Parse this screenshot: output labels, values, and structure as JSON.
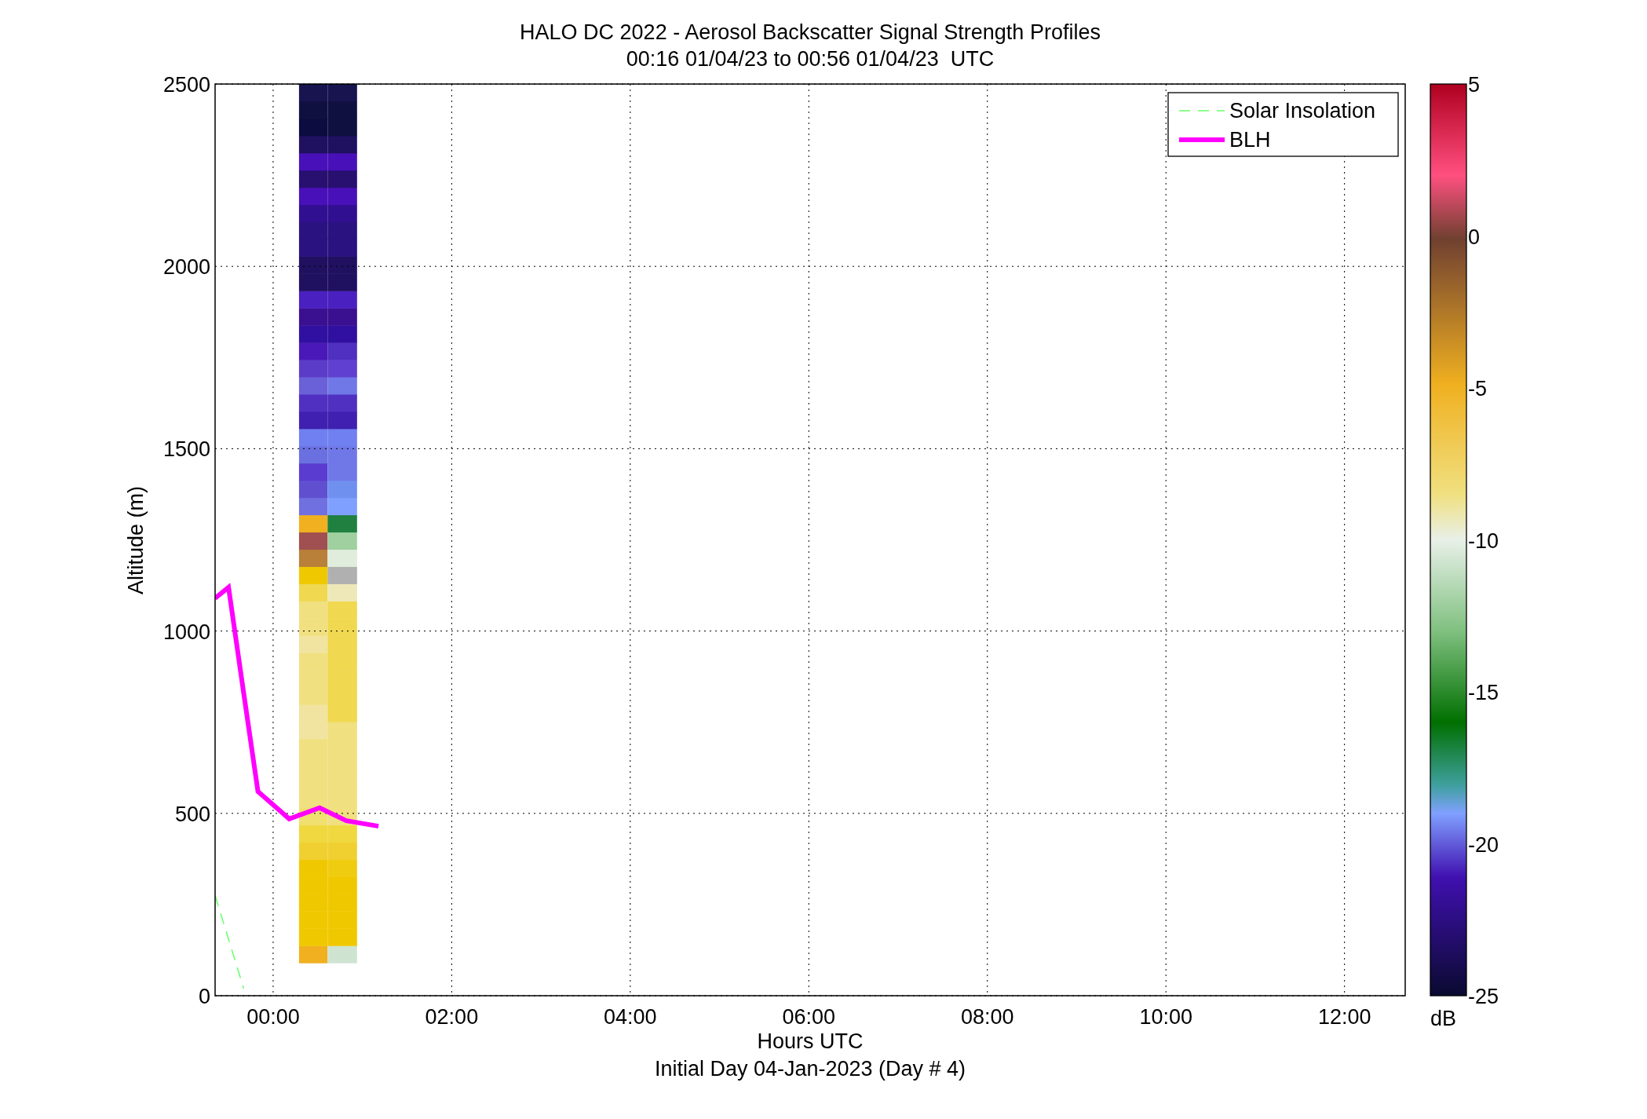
{
  "figure": {
    "subtitle": "00:16 01/04/23 to 00:56 01/04/23  UTC",
    "caption": "Initial Day 04-Jan-2023 (Day # 4)"
  },
  "chart_data": {
    "type": "line",
    "title": "HALO DC 2022 - Aerosol Backscatter Signal Strength Profiles",
    "xlabel": "Hours UTC",
    "ylabel": "Altitude (m)",
    "x": [
      -0.65,
      -0.5,
      -0.33,
      -0.17,
      0.18,
      0.52,
      0.82,
      1.18
    ],
    "series": [
      {
        "name": "Solar Insolation",
        "color": "#66ff66",
        "line_style": "dashed",
        "values": [
          275,
          155,
          20,
          null,
          null,
          null,
          null,
          null
        ]
      },
      {
        "name": "BLH",
        "color": "#ff00ff",
        "line_style": "solid",
        "values": [
          1090,
          1120,
          830,
          560,
          485,
          515,
          480,
          465
        ]
      }
    ],
    "grid": true,
    "legend": true,
    "xlim": [
      -0.65,
      12.68
    ],
    "ylim": [
      0,
      2500
    ],
    "xticks": [
      {
        "value": 0,
        "label": "00:00"
      },
      {
        "value": 2,
        "label": "02:00"
      },
      {
        "value": 4,
        "label": "04:00"
      },
      {
        "value": 6,
        "label": "06:00"
      },
      {
        "value": 8,
        "label": "08:00"
      },
      {
        "value": 10,
        "label": "10:00"
      },
      {
        "value": 12,
        "label": "12:00"
      }
    ],
    "yticks": [
      0,
      500,
      1000,
      1500,
      2000,
      2500
    ]
  },
  "colorbar": {
    "label": "dB",
    "ticks": [
      "5",
      "0",
      "-5",
      "-10",
      "-15",
      "-20",
      "-25"
    ]
  }
}
